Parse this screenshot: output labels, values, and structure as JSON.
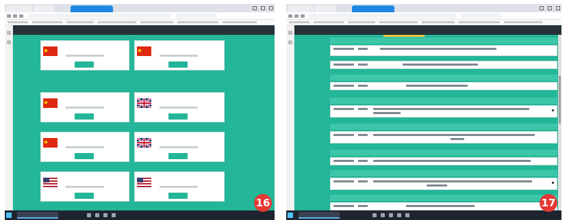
{
  "shots": [
    {
      "badge": "16",
      "browser": {
        "tab_count": 3
      },
      "header": {
        "title": "",
        "links": [
          "",
          "",
          "",
          ""
        ]
      },
      "cards": [
        {
          "flag": "cn-flag-icon",
          "phone": ""
        },
        {
          "flag": "cn-flag-icon",
          "phone": ""
        },
        {
          "flag": "cn-flag-icon",
          "phone": ""
        },
        {
          "flag": "uk-flag-icon",
          "phone": ""
        },
        {
          "flag": "cn-flag-icon",
          "phone": ""
        },
        {
          "flag": "uk-flag-icon",
          "phone": ""
        },
        {
          "flag": "us-flag-icon",
          "phone": ""
        },
        {
          "flag": "us-flag-icon",
          "phone": ""
        }
      ]
    },
    {
      "badge": "17",
      "header": {
        "title": "",
        "links": [
          "",
          "",
          "",
          ""
        ]
      },
      "rows": 12
    }
  ],
  "colors": {
    "teal": "#23b698",
    "header_dark": "#263238",
    "phone_text": "#5aa8cf",
    "badge_red": "#e53935"
  }
}
